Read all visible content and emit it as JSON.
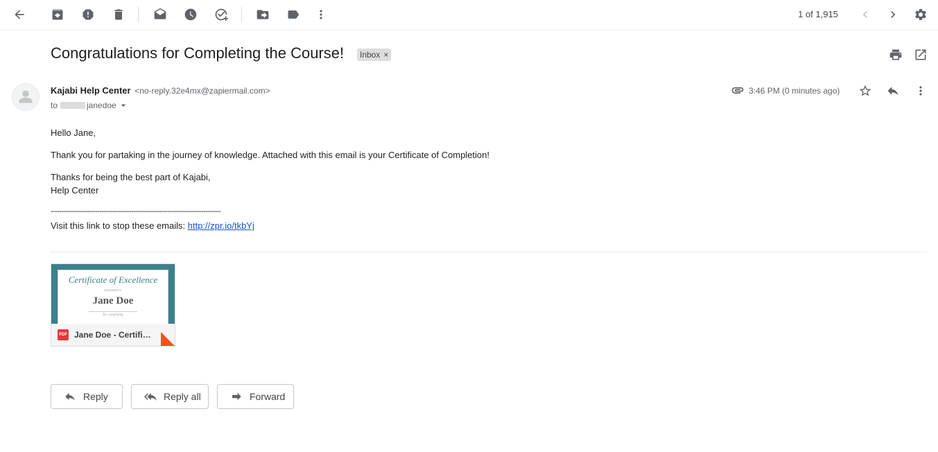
{
  "toolbar": {
    "icons": [
      "back-arrow-icon",
      "archive-icon",
      "report-spam-icon",
      "delete-icon",
      "mark-unread-icon",
      "snooze-icon",
      "add-task-icon",
      "move-to-icon",
      "label-icon",
      "more-vert-icon"
    ],
    "page_count": "1 of 1,915"
  },
  "email": {
    "subject": "Congratulations for Completing the Course!",
    "label": "Inbox",
    "label_close": "×",
    "sender_name": "Kajabi Help Center",
    "sender_email": "<no-reply.32e4mx@zapiermail.com>",
    "to_prefix": "to",
    "to_name": "janedoe",
    "time": "3:46 PM (0 minutes ago)",
    "body": {
      "greeting": "Hello Jane,",
      "paragraph1": "Thank you for partaking in the journey of knowledge. Attached with this email is your Certificate of Completion!",
      "closing1": "Thanks for being the best part of Kajabi,",
      "closing2": "Help Center",
      "divider": "--------------------------------------------------------------------------------",
      "unsub_text": "Visit this link to stop these emails: ",
      "unsub_link": "http://zpr.io/tkbYj"
    }
  },
  "attachment": {
    "cert_title": "Certificate of Excellence",
    "cert_presented": "presented to",
    "cert_name": "Jane Doe",
    "cert_for": "for completing",
    "file_type": "PDF",
    "file_name": "Jane Doe - Certific..."
  },
  "actions": {
    "reply": "Reply",
    "reply_all": "Reply all",
    "forward": "Forward"
  },
  "colors": {
    "certificate_accent": "#3d7f8c",
    "link": "#1155cc",
    "pdf_red": "#e53935"
  }
}
